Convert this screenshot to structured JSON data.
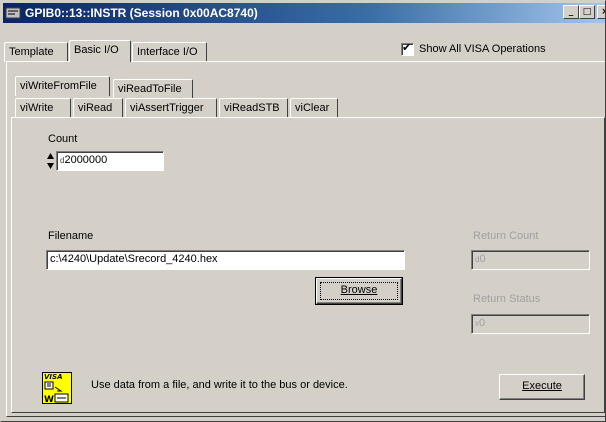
{
  "window": {
    "title": "GPIB0::13::INSTR (Session 0x00AC8740)",
    "minimize_glyph": "_",
    "maximize_glyph": "□",
    "close_glyph": "×"
  },
  "top_tabs": [
    {
      "label": "Template"
    },
    {
      "label": "Basic I/O",
      "active": true
    },
    {
      "label": "Interface I/O"
    }
  ],
  "show_all_visa": {
    "label": "Show All VISA Operations",
    "checked": true,
    "check_glyph": "✔"
  },
  "sub_tabs_row1": [
    {
      "label": "viWriteFromFile",
      "active": true
    },
    {
      "label": "viReadToFile"
    }
  ],
  "sub_tabs_row2": [
    {
      "label": "viWrite"
    },
    {
      "label": "viRead"
    },
    {
      "label": "viAssertTrigger"
    },
    {
      "label": "viReadSTB"
    },
    {
      "label": "viClear"
    }
  ],
  "count": {
    "label": "Count",
    "radix": "d",
    "value": "2000000"
  },
  "filename": {
    "label": "Filename",
    "value": "c:\\4240\\Update\\Srecord_4240.hex"
  },
  "browse_button": {
    "label": "Browse"
  },
  "return_count": {
    "label": "Return Count",
    "radix": "d",
    "value": "0"
  },
  "return_status": {
    "label": "Return Status",
    "radix": "x",
    "value": "0"
  },
  "help": {
    "icon_text": "VISA",
    "description": "Use data from a file, and write it to the bus or device."
  },
  "execute_button": {
    "label": "Execute"
  }
}
